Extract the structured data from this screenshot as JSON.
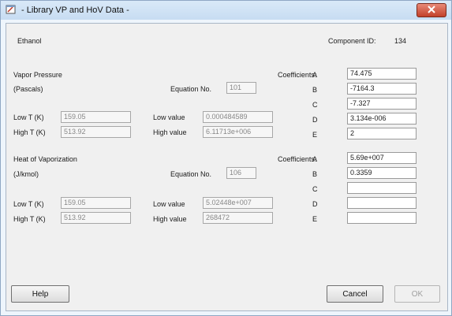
{
  "window": {
    "title": "- Library VP and HoV Data -"
  },
  "header": {
    "compound": "Ethanol",
    "component_id_label": "Component ID:",
    "component_id": "134"
  },
  "vapor_pressure": {
    "title": "Vapor Pressure",
    "units": "(Pascals)",
    "equation_label": "Equation No.",
    "equation_no": "101",
    "low_t_label": "Low T (K)",
    "low_t": "159.05",
    "high_t_label": "High T (K)",
    "high_t": "513.92",
    "low_value_label": "Low value",
    "low_value": "0.000484589",
    "high_value_label": "High value",
    "high_value": "6.11713e+006",
    "coefficients_label": "Coefficients:",
    "coefficients": [
      {
        "name": "A",
        "value": "74.475"
      },
      {
        "name": "B",
        "value": "-7164.3"
      },
      {
        "name": "C",
        "value": "-7.327"
      },
      {
        "name": "D",
        "value": "3.134e-006"
      },
      {
        "name": "E",
        "value": "2"
      }
    ]
  },
  "heat_of_vaporization": {
    "title": "Heat of Vaporization",
    "units": "(J/kmol)",
    "equation_label": "Equation No.",
    "equation_no": "106",
    "low_t_label": "Low T (K)",
    "low_t": "159.05",
    "high_t_label": "High T (K)",
    "high_t": "513.92",
    "low_value_label": "Low value",
    "low_value": "5.02448e+007",
    "high_value_label": "High value",
    "high_value": "268472",
    "coefficients_label": "Coefficients:",
    "coefficients": [
      {
        "name": "A",
        "value": "5.69e+007"
      },
      {
        "name": "B",
        "value": "0.3359"
      },
      {
        "name": "C",
        "value": ""
      },
      {
        "name": "D",
        "value": ""
      },
      {
        "name": "E",
        "value": ""
      }
    ]
  },
  "buttons": {
    "help": "Help",
    "cancel": "Cancel",
    "ok": "OK"
  }
}
